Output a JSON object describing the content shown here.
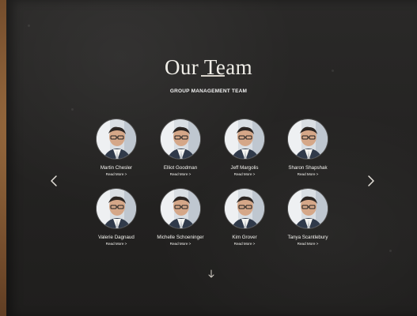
{
  "section": {
    "title": "Our Team",
    "subtitle": "GROUP MANAGEMENT TEAM"
  },
  "navigation": {
    "previous_icon": "chevron-left-icon",
    "next_icon": "chevron-right-icon",
    "scroll_icon": "arrow-down-icon"
  },
  "team": [
    {
      "name": "Martin Chesler",
      "link": "Read More >"
    },
    {
      "name": "Elliot Goodman",
      "link": "Read More >"
    },
    {
      "name": "Jeff Margolis",
      "link": "Read More >"
    },
    {
      "name": "Sharon Shapshak",
      "link": "Read More >"
    },
    {
      "name": "Valerie Dagnaud",
      "link": "Read More >"
    },
    {
      "name": "Michelle Schoeninger",
      "link": "Read More >"
    },
    {
      "name": "Kim Grover",
      "link": "Read More >"
    },
    {
      "name": "Tanya Scantlebury",
      "link": "Read More >"
    }
  ],
  "colors": {
    "panel_background": "#242322",
    "text": "#f7f6f2",
    "wood_edge": "#6b4a2c"
  }
}
